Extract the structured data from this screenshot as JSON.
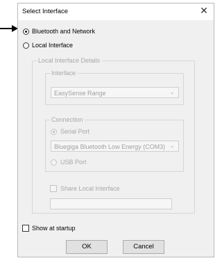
{
  "dialog": {
    "title": "Select Interface",
    "close_glyph": "✕"
  },
  "options": {
    "bluetooth_network": {
      "label": "Bluetooth and Network",
      "selected": true
    },
    "local_interface": {
      "label": "Local Interface",
      "selected": false
    }
  },
  "local_details": {
    "legend": "Local Interface Details",
    "interface_group": {
      "legend": "Interface",
      "selected_value": "EasySense Range"
    },
    "connection_group": {
      "legend": "Connection",
      "serial_port": {
        "label": "Serial Port",
        "selected": true
      },
      "serial_port_device": "Bluegiga Bluetooth Low Energy (COM3)",
      "usb_port": {
        "label": "USB Port",
        "selected": false
      }
    },
    "share_local_interface": {
      "label": "Share Local Interface",
      "checked": false
    },
    "share_text_value": ""
  },
  "show_at_startup": {
    "label": "Show at startup",
    "checked": false
  },
  "buttons": {
    "ok": "OK",
    "cancel": "Cancel"
  },
  "icons": {
    "arrow": "arrow-right-icon",
    "chevron": "chevron-down-icon",
    "close": "close-icon"
  }
}
